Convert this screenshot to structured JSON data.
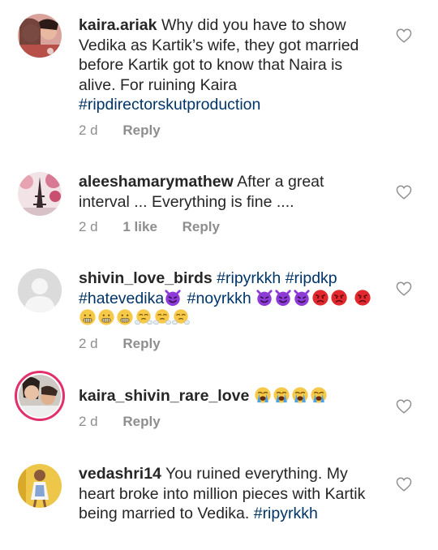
{
  "comments": [
    {
      "username": "kaira.ariak",
      "text": "Why did you have to show Vedika as Kartik’s wife, they got married before Kartik got to know that Naira is alive. For ruining Kaira",
      "hashtags": [
        "#ripdirectorskutproduction"
      ],
      "time": "2 d",
      "likes": "",
      "reply_label": "Reply"
    },
    {
      "username": "aleeshamarymathew",
      "text": "After a great interval ... Everything is fine ....",
      "time": "2 d",
      "likes": "1 like",
      "reply_label": "Reply"
    },
    {
      "username": "shivin_love_birds",
      "hashtags": [
        "#ripyrkkh",
        "#ripdkp",
        "#hatevedika",
        "#noyrkkh"
      ],
      "emoji_names": [
        "smiling-devil",
        "smiling-devil",
        "smiling-devil",
        "smiling-devil",
        "angry-face",
        "angry-face",
        "angry-face",
        "grimacing-face",
        "grimacing-face",
        "grimacing-face",
        "steam-face",
        "steam-face",
        "steam-face"
      ],
      "time": "2 d",
      "likes": "",
      "reply_label": "Reply"
    },
    {
      "username": "kaira_shivin_rare_love",
      "emoji_names": [
        "crying-face",
        "crying-face",
        "crying-face",
        "crying-face"
      ],
      "time": "2 d",
      "likes": "",
      "reply_label": "Reply"
    },
    {
      "username": "vedashri14",
      "text": "You ruined everything. My heart broke into million pieces with Kartik being married to Vedika.",
      "hashtags": [
        "#ripyrkkh"
      ],
      "time": "",
      "likes": "",
      "reply_label": ""
    }
  ],
  "colors": {
    "text": "#262626",
    "meta": "#8e8e8e",
    "hashtag": "#003569",
    "story_ring": "#e1306c",
    "devil": "#8e3ad6",
    "angry": "#e0282e",
    "emoji_yellow": "#f7c948"
  },
  "icons": {
    "like": "heart-outline-icon"
  }
}
